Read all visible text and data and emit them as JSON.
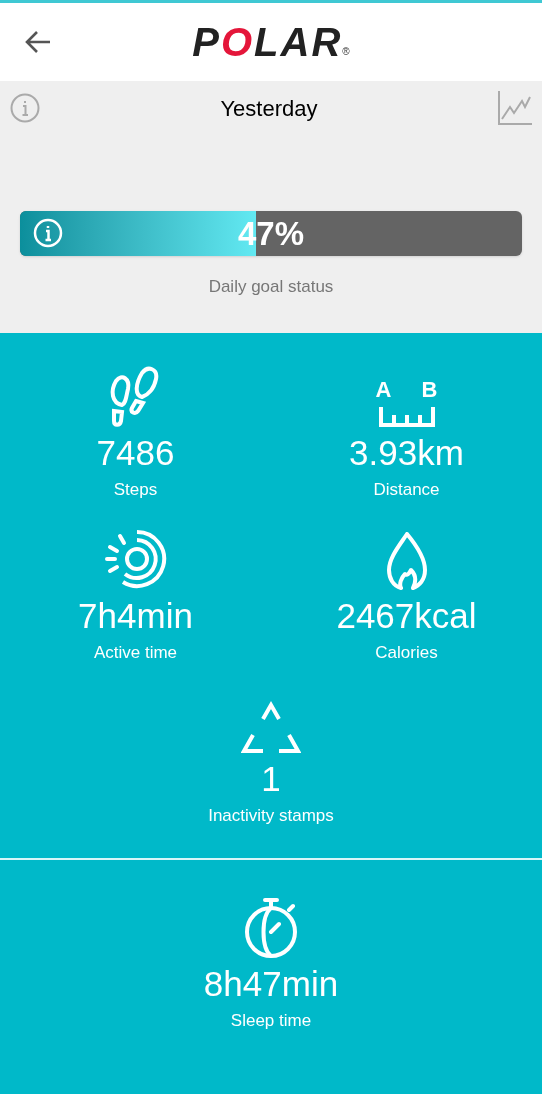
{
  "header": {
    "logo": "POLAR",
    "logo_mark": "®"
  },
  "day": {
    "title": "Yesterday"
  },
  "goal": {
    "level": 0.47,
    "reading": "47%",
    "label": "Daily goal status"
  },
  "metrics": [
    {
      "kind": "steps",
      "value": "7486",
      "label": "Steps"
    },
    {
      "kind": "distance",
      "value": "3.93km",
      "label": "Distance",
      "icon_labels": [
        "A",
        "B"
      ]
    },
    {
      "kind": "active",
      "value": "7h4min",
      "label": "Active time"
    },
    {
      "kind": "calories",
      "value": "2467kcal",
      "label": "Calories"
    },
    {
      "kind": "inactivity",
      "value": "1",
      "label": "Inactivity stamps"
    }
  ],
  "sleep": {
    "kind": "sleep",
    "value": "8h47min",
    "label": "Sleep time"
  }
}
